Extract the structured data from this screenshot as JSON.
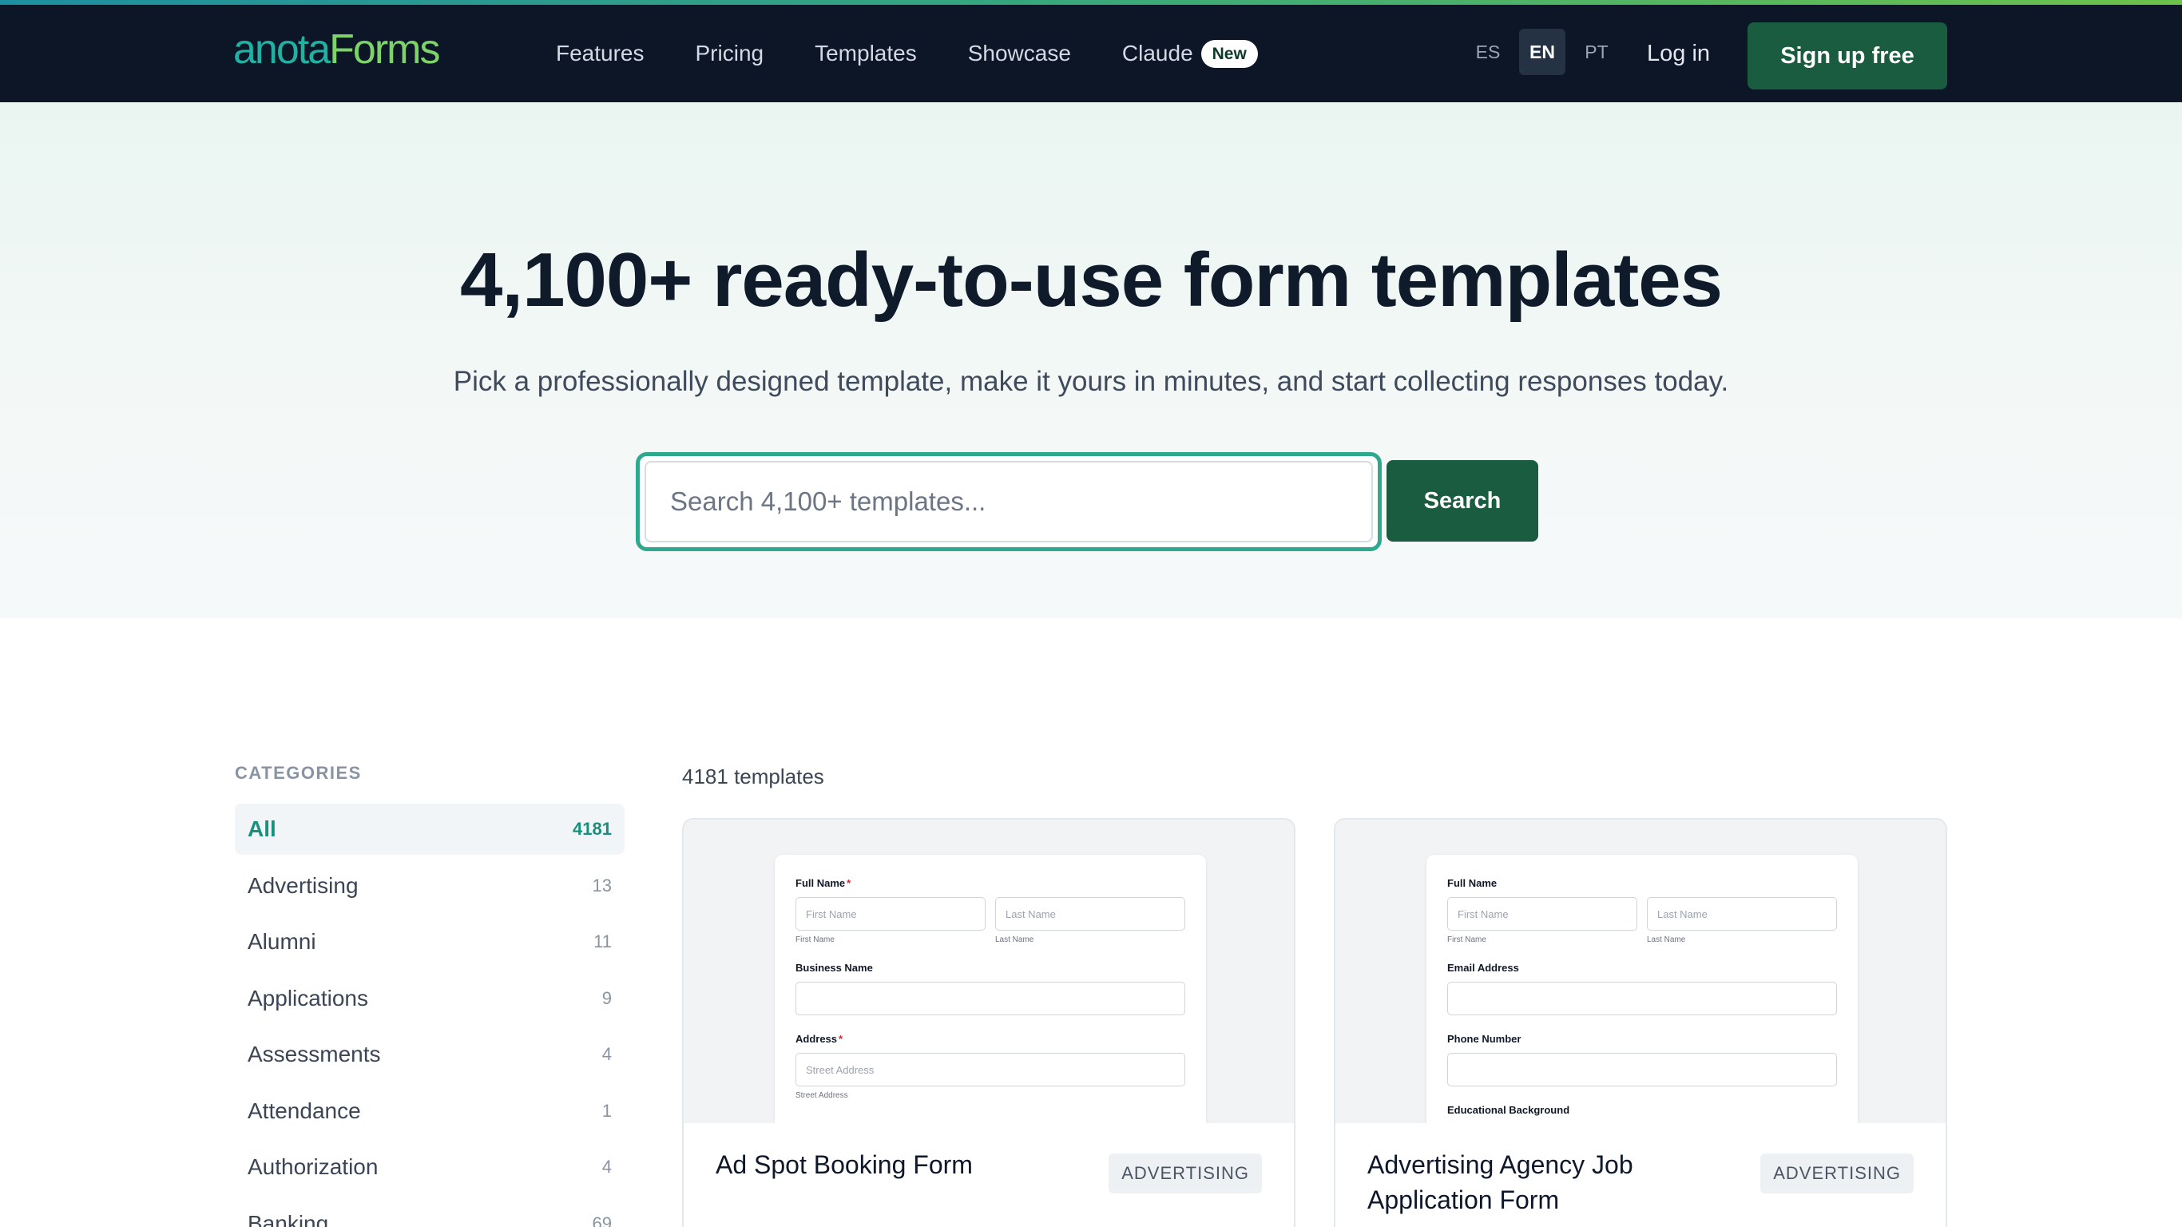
{
  "nav": {
    "logo_part1": "anota",
    "logo_part2": "Forms",
    "links": [
      {
        "label": "Features"
      },
      {
        "label": "Pricing"
      },
      {
        "label": "Templates"
      },
      {
        "label": "Showcase"
      },
      {
        "label": "Claude",
        "badge": "New"
      }
    ],
    "languages": [
      {
        "code": "ES",
        "active": false
      },
      {
        "code": "EN",
        "active": true
      },
      {
        "code": "PT",
        "active": false
      }
    ],
    "login_label": "Log in",
    "signup_label": "Sign up free"
  },
  "hero": {
    "title": "4,100+ ready-to-use form templates",
    "subtitle": "Pick a professionally designed template, make it yours in minutes, and start collecting responses today.",
    "search_placeholder": "Search 4,100+ templates...",
    "search_button": "Search"
  },
  "sidebar": {
    "heading": "CATEGORIES",
    "items": [
      {
        "name": "All",
        "count": "4181",
        "active": true
      },
      {
        "name": "Advertising",
        "count": "13"
      },
      {
        "name": "Alumni",
        "count": "11"
      },
      {
        "name": "Applications",
        "count": "9"
      },
      {
        "name": "Assessments",
        "count": "4"
      },
      {
        "name": "Attendance",
        "count": "1"
      },
      {
        "name": "Authorization",
        "count": "4"
      },
      {
        "name": "Banking",
        "count": "69"
      }
    ]
  },
  "results": {
    "count_label": "4181 templates",
    "cards": [
      {
        "title": "Ad Spot Booking Form",
        "tag": "ADVERTISING",
        "preview": {
          "full_name_label": "Full Name",
          "first_name_placeholder": "First Name",
          "last_name_placeholder": "Last Name",
          "first_name_hint": "First Name",
          "last_name_hint": "Last Name",
          "field2_label": "Business Name",
          "field3_label": "Address",
          "address_placeholder": "Street Address",
          "address_hint": "Street Address"
        }
      },
      {
        "title": "Advertising Agency Job Application Form",
        "tag": "ADVERTISING",
        "preview": {
          "full_name_label": "Full Name",
          "first_name_placeholder": "First Name",
          "last_name_placeholder": "Last Name",
          "first_name_hint": "First Name",
          "last_name_hint": "Last Name",
          "field2_label": "Email Address",
          "field3_label": "Phone Number",
          "field4_label": "Educational Background"
        }
      }
    ]
  }
}
